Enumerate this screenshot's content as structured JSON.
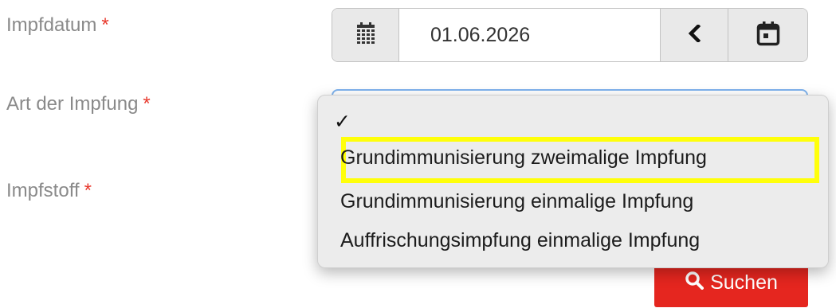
{
  "form": {
    "vaccination_date_label": "Impfdatum",
    "vaccination_type_label": "Art der Impfung",
    "vaccine_label": "Impfstoff",
    "required_marker": "*",
    "date_value": "01.06.2026"
  },
  "dropdown": {
    "checkmark": "✓",
    "options": [
      "Grundimmunisierung zweimalige Impfung",
      "Grundimmunisierung einmalige Impfung",
      "Auffrischungsimpfung einmalige Impfung"
    ],
    "highlighted_index": 0
  },
  "search_button": {
    "label": "Suchen",
    "icon": "search-icon"
  },
  "icons": {
    "date_addon": "calendar-grid-icon",
    "previous": "chevron-left-icon",
    "calendar": "calendar-icon"
  },
  "colors": {
    "required": "#e8382c",
    "search_button": "#e5261f",
    "highlight": "#ffff0a",
    "focus_border": "#7fb3ee"
  }
}
